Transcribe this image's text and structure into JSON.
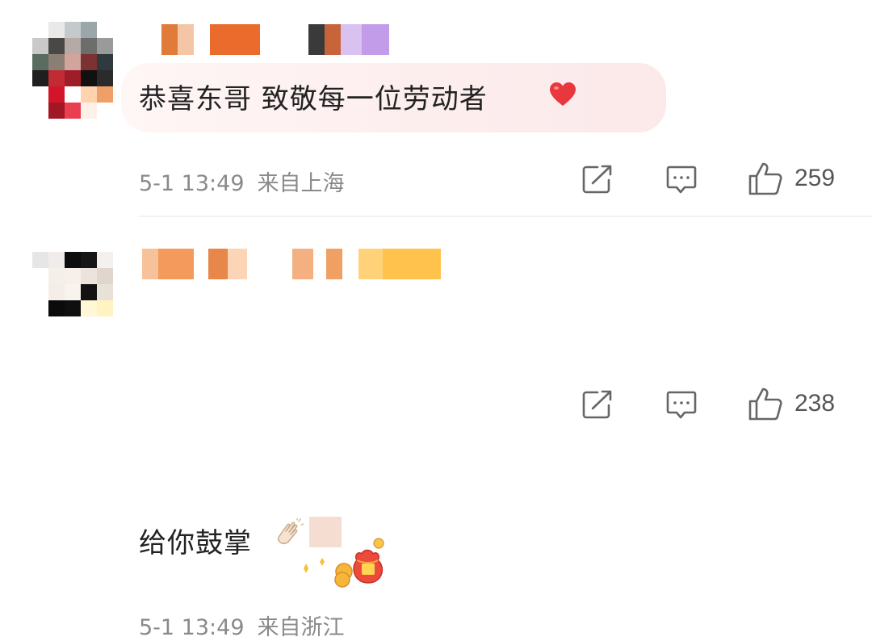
{
  "comments": [
    {
      "text": "恭喜东哥 致敬每一位劳动者",
      "emoji": "heart-icon",
      "time": "5-1 13:49",
      "location": "来自上海",
      "likes": "259"
    },
    {
      "text": "给你鼓掌",
      "emoji": "clap-icon",
      "time": "5-1 13:49",
      "location": "来自浙江",
      "likes": "238"
    }
  ],
  "colors": {
    "heart": "#e8383d",
    "meta_text": "#8a8a8a",
    "bubble": "#fdeeee"
  }
}
